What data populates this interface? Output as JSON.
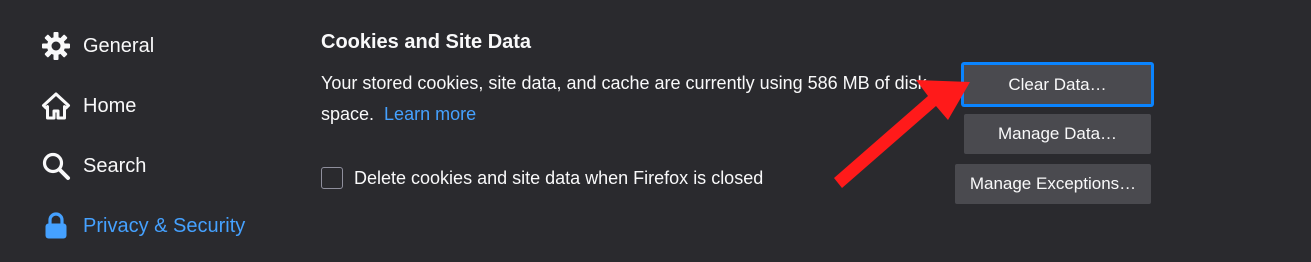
{
  "sidebar": {
    "items": [
      {
        "label": "General",
        "icon": "gear-icon"
      },
      {
        "label": "Home",
        "icon": "home-icon"
      },
      {
        "label": "Search",
        "icon": "search-icon"
      },
      {
        "label": "Privacy & Security",
        "icon": "lock-icon",
        "active": true
      }
    ]
  },
  "cookies": {
    "title": "Cookies and Site Data",
    "description": "Your stored cookies, site data, and cache are currently using 586 MB of disk space.",
    "learn_more": "Learn more",
    "delete_on_close_label": "Delete cookies and site data when Firefox is closed",
    "delete_on_close_checked": false,
    "buttons": {
      "clear_data": "Clear Data…",
      "manage_data": "Manage Data…",
      "manage_exceptions": "Manage Exceptions…"
    }
  },
  "colors": {
    "background": "#2a2a2e",
    "accent": "#45a1ff",
    "button": "#4a4a4f",
    "focus_ring": "#0a84ff",
    "annotation_arrow": "#ff1a1a"
  }
}
